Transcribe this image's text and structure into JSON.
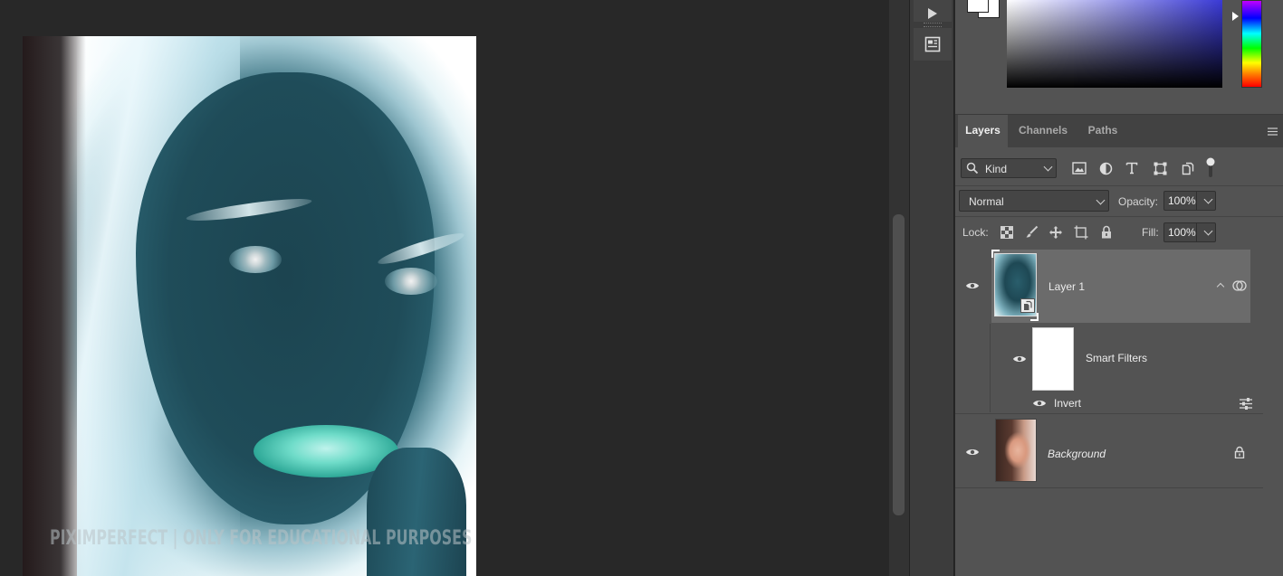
{
  "canvas": {
    "watermark": "PIXIMPERFECT | ONLY FOR EDUCATIONAL PURPOSES"
  },
  "panel_tabs": [
    "Layers",
    "Channels",
    "Paths"
  ],
  "filter": {
    "kind_label": "Kind",
    "filter_icons": [
      "image-filter-icon",
      "adjustment-filter-icon",
      "type-filter-icon",
      "shape-filter-icon",
      "smart-object-filter-icon"
    ]
  },
  "blend": {
    "mode": "Normal",
    "opacity_label": "Opacity:",
    "opacity_value": "100%"
  },
  "lock": {
    "lock_label": "Lock:",
    "fill_label": "Fill:",
    "fill_value": "100%",
    "lock_icons": [
      "lock-transparent-pixels-icon",
      "lock-image-pixels-icon",
      "lock-position-icon",
      "lock-artboard-icon",
      "lock-all-icon"
    ]
  },
  "layers": [
    {
      "name": "Layer 1",
      "type": "smart-object",
      "visible": true,
      "selected": true
    },
    {
      "name": "Smart Filters",
      "type": "smart-filters",
      "visible": true
    },
    {
      "name": "Invert",
      "type": "filter",
      "visible": true
    },
    {
      "name": "Background",
      "type": "background",
      "visible": true,
      "locked": true
    }
  ],
  "colors": {
    "panel_bg": "#535353",
    "selected_layer": "#6b6b6b",
    "canvas_bg": "#282828"
  }
}
